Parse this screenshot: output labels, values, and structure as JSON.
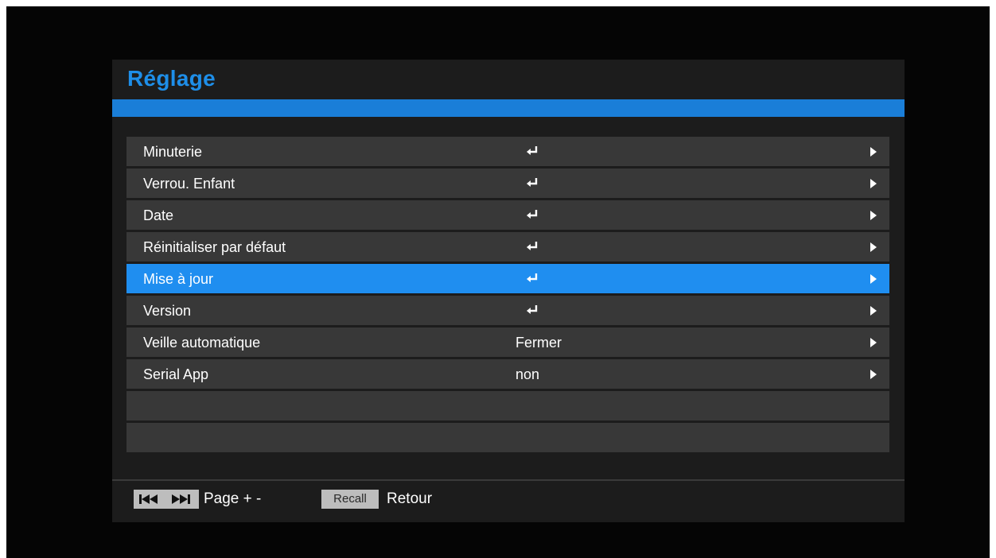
{
  "menu": {
    "title": "Réglage",
    "items": [
      {
        "label": "Minuterie",
        "value": "",
        "icon": "enter-icon",
        "selected": false
      },
      {
        "label": "Verrou. Enfant",
        "value": "",
        "icon": "enter-icon",
        "selected": false
      },
      {
        "label": "Date",
        "value": "",
        "icon": "enter-icon",
        "selected": false
      },
      {
        "label": "Réinitialiser par défaut",
        "value": "",
        "icon": "enter-icon",
        "selected": false
      },
      {
        "label": "Mise à jour",
        "value": "",
        "icon": "enter-icon",
        "selected": true
      },
      {
        "label": "Version",
        "value": "",
        "icon": "enter-icon",
        "selected": false
      },
      {
        "label": "Veille automatique",
        "value": "Fermer",
        "icon": "",
        "selected": false
      },
      {
        "label": "Serial App",
        "value": "non",
        "icon": "",
        "selected": false
      }
    ],
    "empty_rows": 2
  },
  "footer": {
    "page_label": "Page + -",
    "recall_key": "Recall",
    "recall_label": "Retour"
  },
  "colors": {
    "accent": "#1f8ef0",
    "title": "#1e8ee8",
    "row": "#383838",
    "panel": "#1c1c1c"
  }
}
